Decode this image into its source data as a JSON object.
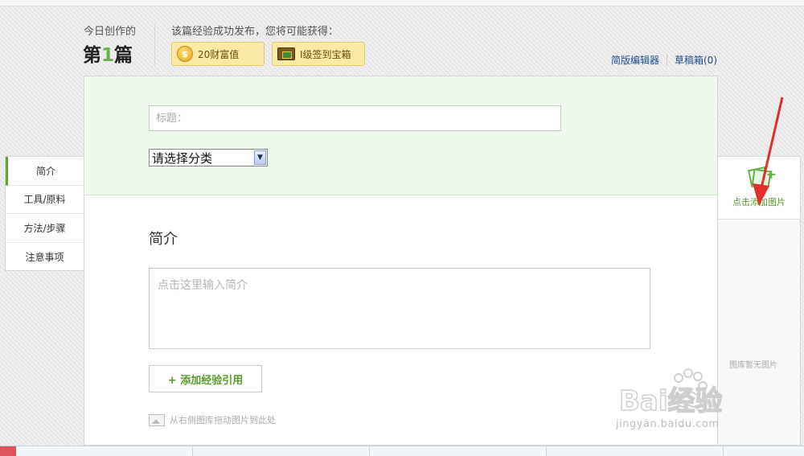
{
  "header": {
    "today_label": "今日创作的",
    "count_prefix": "第",
    "count_value": "1",
    "count_suffix": "篇",
    "publish_note": "该篇经验成功发布，您将可能获得：",
    "rewards": [
      {
        "icon": "coin-icon",
        "label": "20财富值"
      },
      {
        "icon": "treasure-chest-icon",
        "label": "I级签到宝箱"
      }
    ],
    "links": {
      "simple_editor": "简版编辑器",
      "drafts": "草稿箱(0)"
    }
  },
  "form": {
    "title_placeholder": "标题：",
    "category_selected": "请选择分类"
  },
  "section": {
    "title": "简介",
    "intro_placeholder": "点击这里输入简介",
    "add_reference": "+ 添加经验引用",
    "drag_tip": "从右侧图库拖动图片到此处"
  },
  "left_nav": {
    "items": [
      {
        "label": "简介",
        "active": true
      },
      {
        "label": "工具/原料",
        "active": false
      },
      {
        "label": "方法/步骤",
        "active": false
      },
      {
        "label": "注意事项",
        "active": false
      }
    ]
  },
  "right_panel": {
    "add_picture": "点击添加图片",
    "empty_gallery": "图库暂无图片"
  },
  "watermark": {
    "logo_text": "Bai经验",
    "url": "jingyan.baidu.com"
  },
  "colors": {
    "accent_green": "#5aa82c",
    "link_blue": "#1e4e8c",
    "reward_bg": "#fbe9a6",
    "annotation_red": "#e0302a"
  }
}
